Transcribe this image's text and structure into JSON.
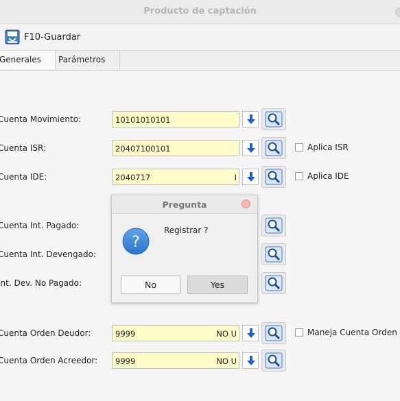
{
  "window": {
    "title": "Producto de captación"
  },
  "toolbar": {
    "save_label": "F10-Guardar",
    "save_icon": "save-icon"
  },
  "tabs": [
    {
      "label": "Generales",
      "active": true
    },
    {
      "label": "Parámetros",
      "active": false
    }
  ],
  "fields": [
    {
      "label": "Cuenta Movimiento:",
      "value": "10101010101",
      "suffix": ""
    },
    {
      "label": "Cuenta ISR:",
      "value": "20407100101",
      "suffix": "",
      "checkbox": "Aplica ISR"
    },
    {
      "label": "Cuenta IDE:",
      "value": "2040717",
      "suffix": "I",
      "checkbox": "Aplica IDE"
    },
    {
      "label": "Cuenta Int. Pagado:"
    },
    {
      "label": "Cuenta Int. Devengado:"
    },
    {
      "label": "Int. Dev. No Pagado:"
    },
    {
      "label": "Cuenta Orden Deudor:",
      "value": "9999",
      "suffix": "NO U",
      "checkbox": "Maneja Cuenta Orden"
    },
    {
      "label": "Cuenta Orden Acreedor:",
      "value": "9999",
      "suffix": "NO U"
    }
  ],
  "dialog": {
    "title": "Pregunta",
    "message": "Registrar ?",
    "no_label": "No",
    "yes_label": "Yes",
    "icon": "question-icon"
  },
  "colors": {
    "field_bg": "#fdfbc8",
    "accent_blue": "#1a5fd6"
  }
}
